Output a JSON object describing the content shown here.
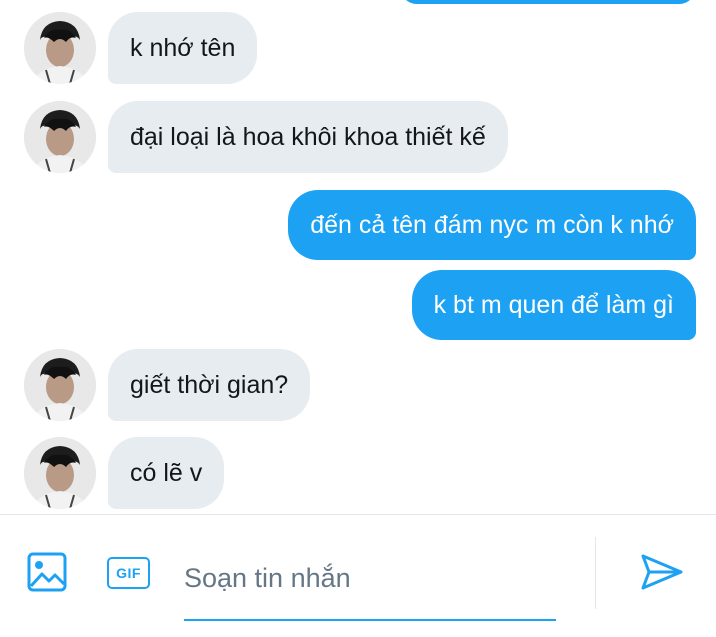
{
  "conversation": {
    "messages": [
      {
        "side": "in",
        "text": "k nhớ tên"
      },
      {
        "side": "in",
        "text": "đại loại là hoa khôi khoa thiết kế"
      },
      {
        "side": "out",
        "text": "đến cả tên đám nyc m còn k nhớ"
      },
      {
        "side": "out",
        "text": "k bt m quen để làm gì"
      },
      {
        "side": "in",
        "text": "giết thời gian?"
      },
      {
        "side": "in",
        "text": "có lẽ v"
      }
    ]
  },
  "composer": {
    "gif_label": "GIF",
    "placeholder": "Soạn tin nhắn",
    "media_icon": "image-icon",
    "send_icon": "send-icon"
  },
  "colors": {
    "accent": "#1da1f2",
    "incoming_bubble": "#e6ecf0",
    "text": "#14171a",
    "placeholder": "#657786"
  }
}
